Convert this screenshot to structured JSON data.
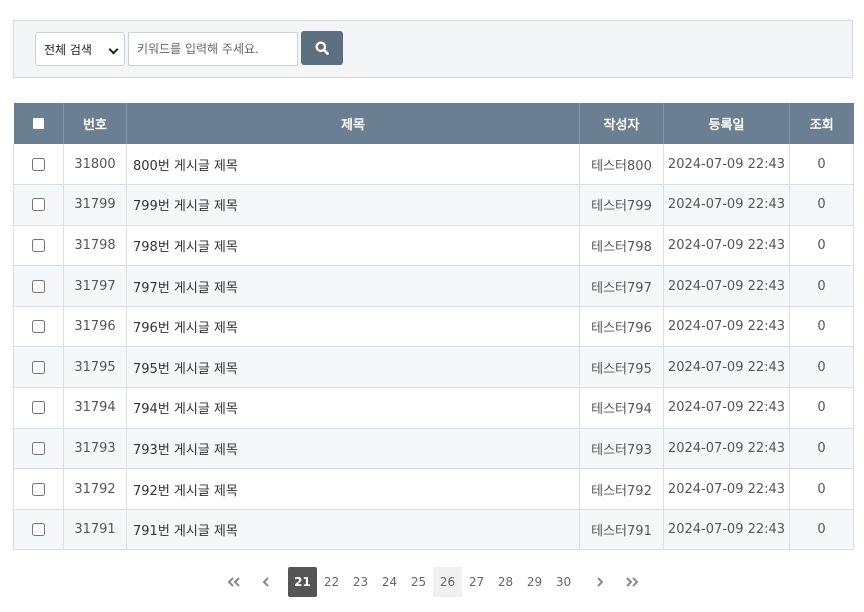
{
  "search": {
    "scope_selected": "전체 검색",
    "placeholder": "키워드를 입력해 주세요.",
    "value": ""
  },
  "table": {
    "headers": {
      "number": "번호",
      "title": "제목",
      "author": "작성자",
      "date": "등록일",
      "views": "조회"
    },
    "rows": [
      {
        "number": "31800",
        "title": "800번 게시글 제목",
        "author": "테스터800",
        "date": "2024-07-09 22:43",
        "views": "0"
      },
      {
        "number": "31799",
        "title": "799번 게시글 제목",
        "author": "테스터799",
        "date": "2024-07-09 22:43",
        "views": "0"
      },
      {
        "number": "31798",
        "title": "798번 게시글 제목",
        "author": "테스터798",
        "date": "2024-07-09 22:43",
        "views": "0"
      },
      {
        "number": "31797",
        "title": "797번 게시글 제목",
        "author": "테스터797",
        "date": "2024-07-09 22:43",
        "views": "0"
      },
      {
        "number": "31796",
        "title": "796번 게시글 제목",
        "author": "테스터796",
        "date": "2024-07-09 22:43",
        "views": "0"
      },
      {
        "number": "31795",
        "title": "795번 게시글 제목",
        "author": "테스터795",
        "date": "2024-07-09 22:43",
        "views": "0"
      },
      {
        "number": "31794",
        "title": "794번 게시글 제목",
        "author": "테스터794",
        "date": "2024-07-09 22:43",
        "views": "0"
      },
      {
        "number": "31793",
        "title": "793번 게시글 제목",
        "author": "테스터793",
        "date": "2024-07-09 22:43",
        "views": "0"
      },
      {
        "number": "31792",
        "title": "792번 게시글 제목",
        "author": "테스터792",
        "date": "2024-07-09 22:43",
        "views": "0"
      },
      {
        "number": "31791",
        "title": "791번 게시글 제목",
        "author": "테스터791",
        "date": "2024-07-09 22:43",
        "views": "0"
      }
    ]
  },
  "pagination": {
    "first": "«",
    "prev": "‹",
    "pages": [
      "21",
      "22",
      "23",
      "24",
      "25",
      "26",
      "27",
      "28",
      "29",
      "30"
    ],
    "current": "21",
    "next": "›",
    "last": "»"
  },
  "colors": {
    "header_bg": "#6b7f92",
    "search_button_bg": "#5e6f82",
    "active_page_bg": "#555555"
  }
}
